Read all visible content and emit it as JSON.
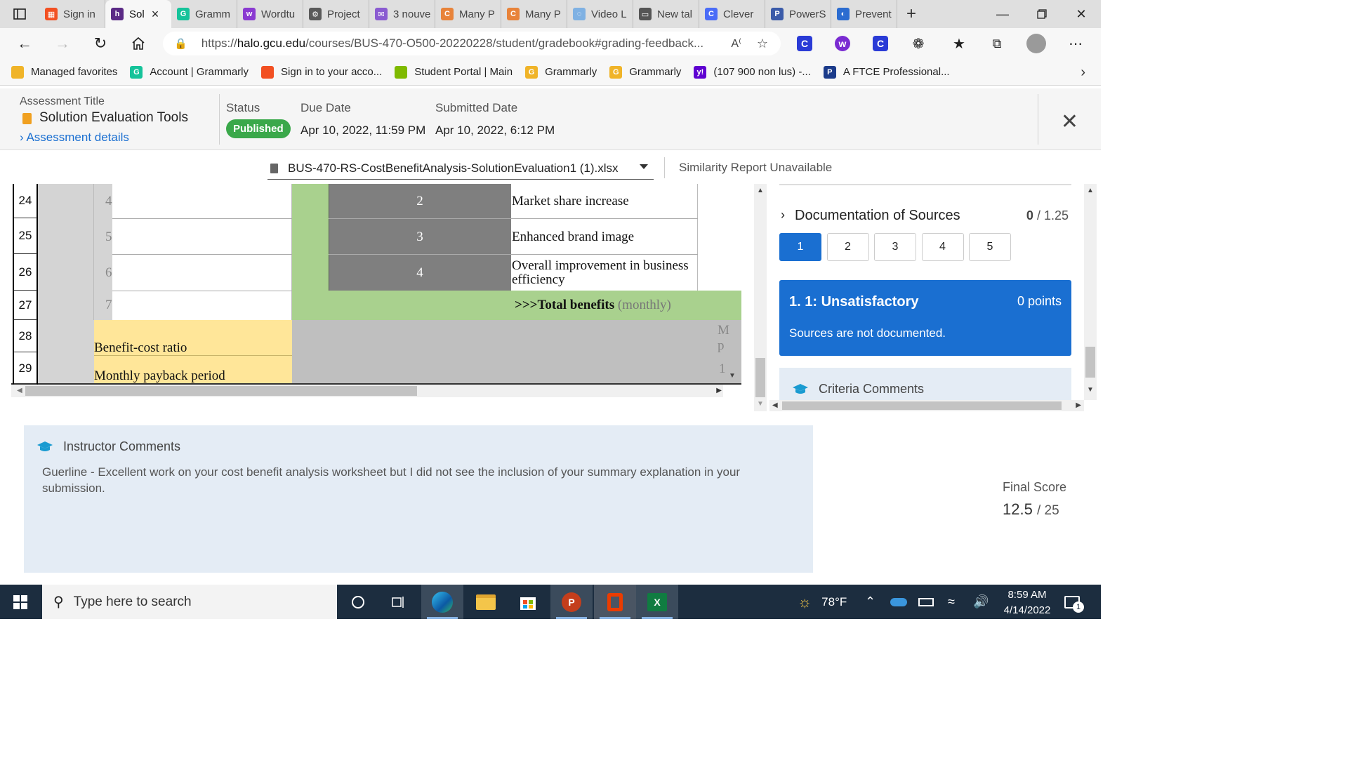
{
  "browser": {
    "tabs": [
      {
        "label": "Sign in",
        "color": "#f25022",
        "glyph": "▦"
      },
      {
        "label": "Sol",
        "color": "#5b2a86",
        "glyph": "h",
        "active": true
      },
      {
        "label": "Gramm",
        "color": "#15c39a",
        "glyph": "G"
      },
      {
        "label": "Wordtu",
        "color": "#8a3ad1",
        "glyph": "w"
      },
      {
        "label": "Project",
        "color": "#5a5a5a",
        "glyph": "⚙"
      },
      {
        "label": "3 nouve",
        "color": "#8a5bd1",
        "glyph": "✉"
      },
      {
        "label": "Many P",
        "color": "#e8833a",
        "glyph": "C"
      },
      {
        "label": "Many P",
        "color": "#e8833a",
        "glyph": "C"
      },
      {
        "label": "Video L",
        "color": "#7fb1e3",
        "glyph": "◌"
      },
      {
        "label": "New tal",
        "color": "#555555",
        "glyph": "▭"
      },
      {
        "label": "Clever",
        "color": "#4a6cf7",
        "glyph": "C"
      },
      {
        "label": "PowerS",
        "color": "#3b5ba9",
        "glyph": "P"
      },
      {
        "label": "Prevent",
        "color": "#2b6cd0",
        "glyph": "◐"
      }
    ],
    "url_prefix": "https://",
    "url_domain": "halo.gcu.edu",
    "url_path": "/courses/BUS-470-O500-20220228/student/gradebook#grading-feedback...",
    "bookmarks": [
      {
        "label": "Managed favorites",
        "color": "#f0b429",
        "glyph": ""
      },
      {
        "label": "Account | Grammarly",
        "color": "#15c39a",
        "glyph": "G"
      },
      {
        "label": "Sign in to your acco...",
        "color": "#f25022",
        "glyph": ""
      },
      {
        "label": "Student Portal | Main",
        "color": "#7fba00",
        "glyph": ""
      },
      {
        "label": "Grammarly",
        "color": "#f0b429",
        "glyph": "G"
      },
      {
        "label": "Grammarly",
        "color": "#f0b429",
        "glyph": "G"
      },
      {
        "label": "(107 900 non lus) -...",
        "color": "#5f01d1",
        "glyph": "y!"
      },
      {
        "label": "A FTCE Professional...",
        "color": "#1b3b8a",
        "glyph": "P"
      }
    ]
  },
  "assessment": {
    "title_label": "Assessment Title",
    "title": "Solution Evaluation Tools",
    "details_link": "Assessment details",
    "status_label": "Status",
    "status": "Published",
    "due_label": "Due Date",
    "due": "Apr 10, 2022, 11:59 PM",
    "submitted_label": "Submitted Date",
    "submitted": "Apr 10, 2022, 6:12 PM"
  },
  "file": {
    "name": "BUS-470-RS-CostBenefitAnalysis-SolutionEvaluation1 (1).xlsx",
    "similarity": "Similarity Report Unavailable"
  },
  "sheet": {
    "rows": [
      {
        "num": "24",
        "idx": "4",
        "mid": "2",
        "label": "Market share increase"
      },
      {
        "num": "25",
        "idx": "5",
        "mid": "3",
        "label": "Enhanced brand image"
      },
      {
        "num": "26",
        "idx": "6",
        "mid": "4",
        "label": "Overall improvement in business efficiency"
      },
      {
        "num": "27",
        "idx": "7",
        "mid": "",
        "label_bold": ">>>Total benefits",
        "label_gray": "(monthly)"
      },
      {
        "num": "28",
        "label": "Benefit-cost ratio",
        "edge": "M p"
      },
      {
        "num": "29",
        "label": "Monthly payback period",
        "edge": "1"
      }
    ]
  },
  "rubric": {
    "criterion": "Documentation of Sources",
    "score": "0",
    "max": "/ 1.25",
    "levels": [
      "1",
      "2",
      "3",
      "4",
      "5"
    ],
    "selected_name": "1. 1: Unsatisfactory",
    "selected_points": "0 points",
    "selected_desc": "Sources are not documented.",
    "criteria_comments": "Criteria Comments"
  },
  "comments": {
    "title": "Instructor Comments",
    "body": "Guerline - Excellent work on your cost benefit analysis worksheet but I did not see the inclusion of your summary explanation in your submission."
  },
  "final": {
    "label": "Final Score",
    "score": "12.5",
    "max": "/ 25"
  },
  "taskbar": {
    "search_placeholder": "Type here to search",
    "weather": "78°F",
    "time": "8:59 AM",
    "date": "4/14/2022",
    "notifications": "1"
  }
}
